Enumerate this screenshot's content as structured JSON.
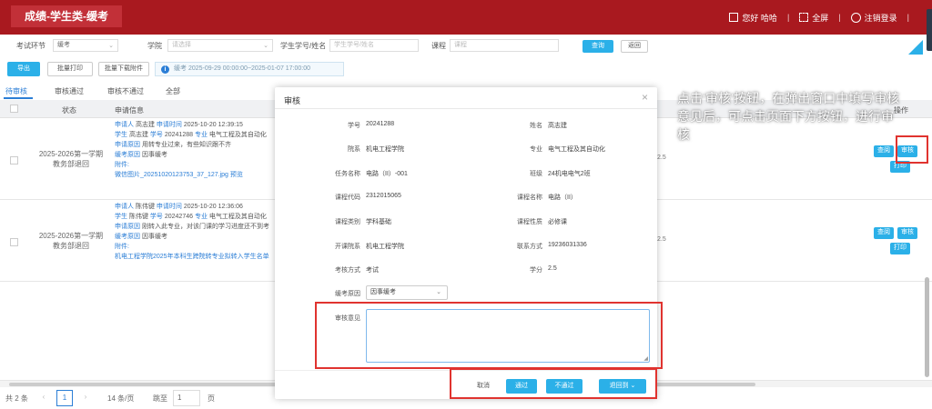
{
  "header": {
    "app_title": "成绩-学生类-缓考",
    "greeting": "您好 哈哈",
    "fullscreen": "全屏",
    "logout": "注销登录",
    "extra_sep": "|"
  },
  "filters": {
    "exam_stage_label": "考试环节",
    "exam_stage_value": "缓考",
    "college_label": "学院",
    "college_placeholder": "请选择",
    "student_label": "学生学号/姓名",
    "student_placeholder": "学生学号/姓名",
    "course_label": "课程",
    "course_placeholder": "课程",
    "query_btn": "查询",
    "reset_btn": "返回"
  },
  "actions": {
    "export": "导出",
    "batch_print": "批量打印",
    "batch_download": "批量下载附件",
    "notice": "缓考 2025-09-29 00:00:00~2025-01-07 17:00:00"
  },
  "tabs": [
    {
      "label": "待审核"
    },
    {
      "label": "审核通过"
    },
    {
      "label": "审核不通过"
    },
    {
      "label": "全部"
    }
  ],
  "table": {
    "headers": {
      "status": "状态",
      "info": "申请信息",
      "op": "操作"
    },
    "rows": [
      {
        "status_line1": "2025-2026第一学期",
        "status_line2": "教务部退回",
        "applicant_k": "申请人",
        "applicant_v": "高志建",
        "time_k": "申请时间",
        "time_v": "2025-10-20 12:39:15",
        "student_k": "学生",
        "student_v": "高志建",
        "sno_k": "学号",
        "sno_v": "20241288",
        "major_k": "专业",
        "major_v": "电气工程及其自动化",
        "reason_k": "申请原因",
        "reason_v": "用转专业过来，有些知识跟不齐",
        "type_k": "缓考原因",
        "type_v": "因事缓考",
        "attach_k": "附件:",
        "attach_v": "微信图片_20251020123753_37_127.jpg",
        "preview": "预览",
        "score": "2.5",
        "btn_view": "查阅",
        "btn_audit": "审核",
        "btn_print": "打印"
      },
      {
        "status_line1": "2025-2026第一学期",
        "status_line2": "教务部退回",
        "applicant_k": "申请人",
        "applicant_v": "陈伟键",
        "time_k": "申请时间",
        "time_v": "2025-10-20 12:36:06",
        "student_k": "学生",
        "student_v": "陈伟键",
        "sno_k": "学号",
        "sno_v": "20242746",
        "major_k": "专业",
        "major_v": "电气工程及其自动化",
        "reason_k": "申请原因",
        "reason_v": "刚转入此专业，对该门课的学习进度还不到考",
        "type_k": "缓考原因",
        "type_v": "因事缓考",
        "attach_k": "附件:",
        "attach_v": "机电工程学院2025年本科生跨院转专业拟转入学生名单",
        "score": "2.5",
        "btn_view": "查阅",
        "btn_audit": "审核",
        "btn_print": "打印"
      }
    ]
  },
  "pager": {
    "total": "共 2 条",
    "prev": "‹",
    "page": "1",
    "next": "›",
    "size": "14 条/页",
    "goto_label": "跳至",
    "goto_value": "1",
    "page_unit": "页"
  },
  "modal": {
    "title": "审核",
    "close": "×",
    "fields": [
      {
        "label": "学号",
        "value": "20241288"
      },
      {
        "label": "姓名",
        "value": "高志建"
      },
      {
        "label": "院系",
        "value": "机电工程学院"
      },
      {
        "label": "专业",
        "value": "电气工程及其自动化"
      },
      {
        "label": "任务名称",
        "value": "电路（II）-001"
      },
      {
        "label": "班级",
        "value": "24机电电气2班"
      },
      {
        "label": "课程代码",
        "value": "2312015065"
      },
      {
        "label": "课程名称",
        "value": "电路（II）"
      },
      {
        "label": "课程类别",
        "value": "学科基础"
      },
      {
        "label": "课程性质",
        "value": "必修课"
      },
      {
        "label": "开课院系",
        "value": "机电工程学院"
      },
      {
        "label": "联系方式",
        "value": "19236031336"
      },
      {
        "label": "考核方式",
        "value": "考试"
      },
      {
        "label": "学分",
        "value": "2.5"
      }
    ],
    "reason_label": "缓考原因",
    "reason_value": "因事缓考",
    "opinion_label": "审核意见",
    "opinion_value": "",
    "cancel": "取消",
    "pass": "通过",
    "fail": "不通过",
    "return": "退回到 ⌄"
  },
  "instruction": "点击‘审核’按钮，在弹出窗口中填写审核意见后，可点击页面下方按钮，进行审核",
  "colors": {
    "brand": "#a9191f",
    "accent": "#2bb0e8",
    "highlight": "#e0332f"
  }
}
